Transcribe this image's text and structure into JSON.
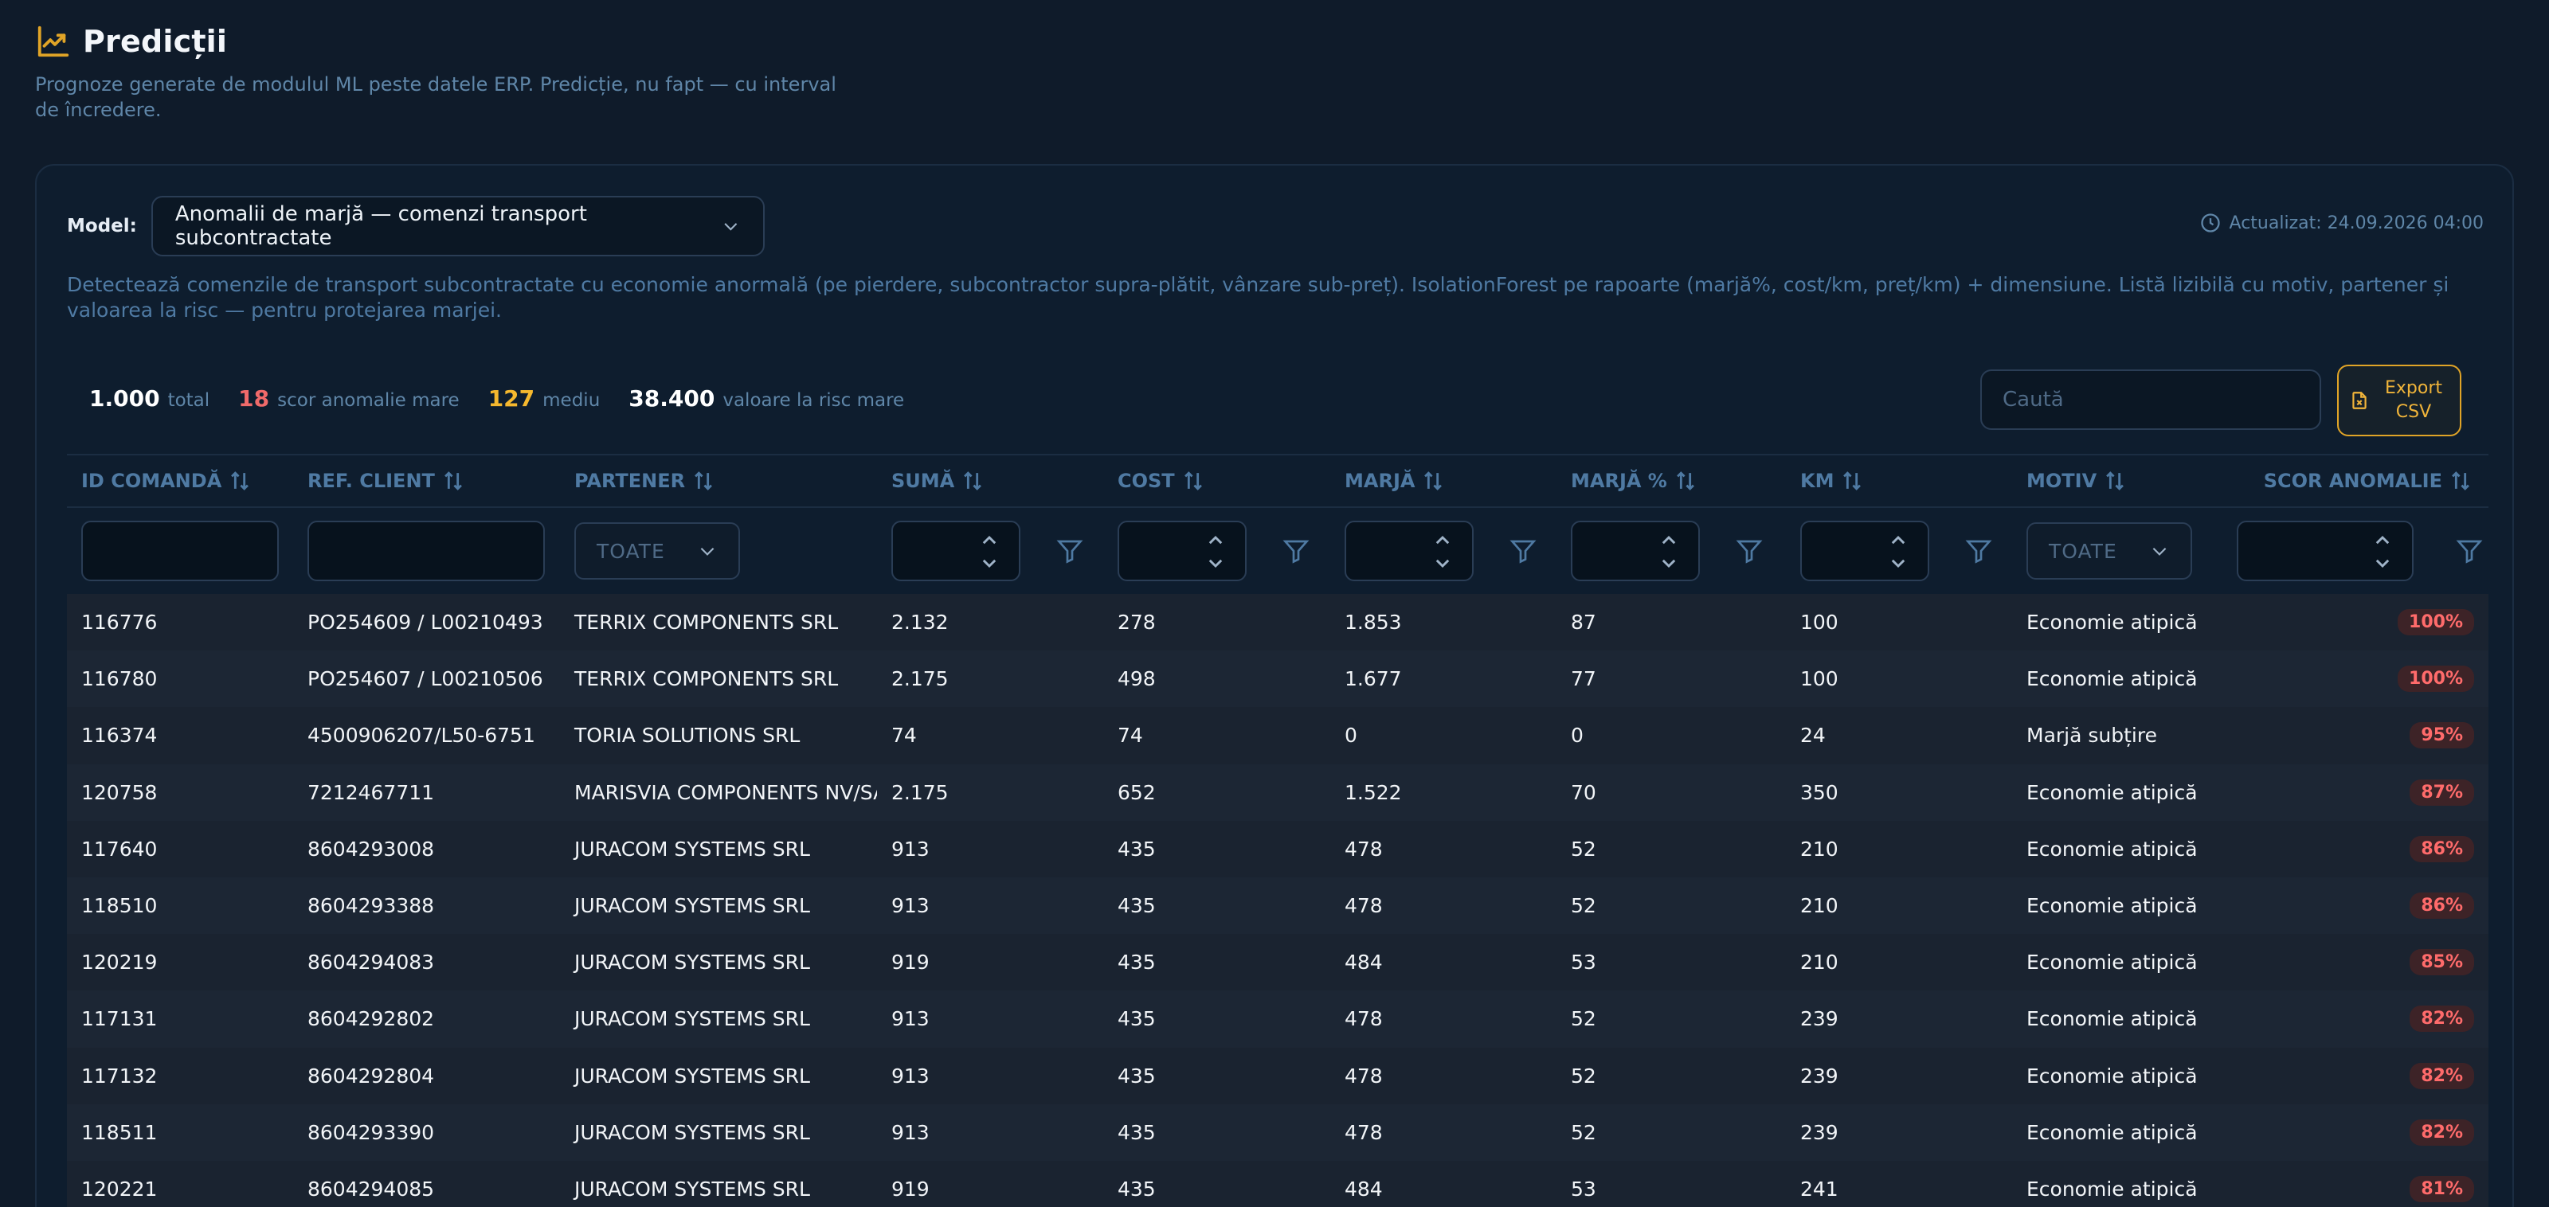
{
  "header": {
    "title": "Predicții",
    "subtitle": "Prognoze generate de modulul ML peste datele ERP. Predicție, nu fapt — cu interval de încredere."
  },
  "model": {
    "label": "Model:",
    "selected": "Anomalii de marjă — comenzi transport subcontractate",
    "updated": "Actualizat: 24.09.2026 04:00",
    "description": "Detectează comenzile de transport subcontractate cu economie anormală (pe pierdere, subcontractor supra-plătit, vânzare sub-preț). IsolationForest pe rapoarte (marjă%, cost/km, preț/km) + dimensiune. Listă lizibilă cu motiv, partener și valoarea la risc — pentru protejarea marjei."
  },
  "stats": {
    "total_value": "1.000",
    "total_label": "total",
    "high_value": "18",
    "high_label": "scor anomalie mare",
    "mid_value": "127",
    "mid_label": "mediu",
    "risk_value": "38.400",
    "risk_label": "valoare la risc mare"
  },
  "search": {
    "placeholder": "Caută"
  },
  "export": {
    "label": "Export CSV"
  },
  "colors": {
    "accent": "#e0a427",
    "danger": "#f06a6a",
    "warning": "#f5b82e"
  },
  "table": {
    "columns": [
      "ID Comandă",
      "Ref. Client",
      "Partener",
      "Sumă",
      "Cost",
      "Marjă",
      "Marjă %",
      "KM",
      "Motiv",
      "Scor anomalie"
    ],
    "filter_all": "TOATE",
    "rows": [
      [
        "116776",
        "PO254609 / L00210493",
        "TERRIX COMPONENTS SRL",
        "2.132",
        "278",
        "1.853",
        "87",
        "100",
        "Economie atipică",
        "100%"
      ],
      [
        "116780",
        "PO254607 / L00210506",
        "TERRIX COMPONENTS SRL",
        "2.175",
        "498",
        "1.677",
        "77",
        "100",
        "Economie atipică",
        "100%"
      ],
      [
        "116374",
        "4500906207/L50-6751",
        "TORIA SOLUTIONS SRL",
        "74",
        "74",
        "0",
        "0",
        "24",
        "Marjă subțire",
        "95%"
      ],
      [
        "120758",
        "7212467711",
        "MARISVIA COMPONENTS NV/SA",
        "2.175",
        "652",
        "1.522",
        "70",
        "350",
        "Economie atipică",
        "87%"
      ],
      [
        "117640",
        "8604293008",
        "JURACOM SYSTEMS SRL",
        "913",
        "435",
        "478",
        "52",
        "210",
        "Economie atipică",
        "86%"
      ],
      [
        "118510",
        "8604293388",
        "JURACOM SYSTEMS SRL",
        "913",
        "435",
        "478",
        "52",
        "210",
        "Economie atipică",
        "86%"
      ],
      [
        "120219",
        "8604294083",
        "JURACOM SYSTEMS SRL",
        "919",
        "435",
        "484",
        "53",
        "210",
        "Economie atipică",
        "85%"
      ],
      [
        "117131",
        "8604292802",
        "JURACOM SYSTEMS SRL",
        "913",
        "435",
        "478",
        "52",
        "239",
        "Economie atipică",
        "82%"
      ],
      [
        "117132",
        "8604292804",
        "JURACOM SYSTEMS SRL",
        "913",
        "435",
        "478",
        "52",
        "239",
        "Economie atipică",
        "82%"
      ],
      [
        "118511",
        "8604293390",
        "JURACOM SYSTEMS SRL",
        "913",
        "435",
        "478",
        "52",
        "239",
        "Economie atipică",
        "82%"
      ],
      [
        "120221",
        "8604294085",
        "JURACOM SYSTEMS SRL",
        "919",
        "435",
        "484",
        "53",
        "241",
        "Economie atipică",
        "81%"
      ]
    ]
  }
}
